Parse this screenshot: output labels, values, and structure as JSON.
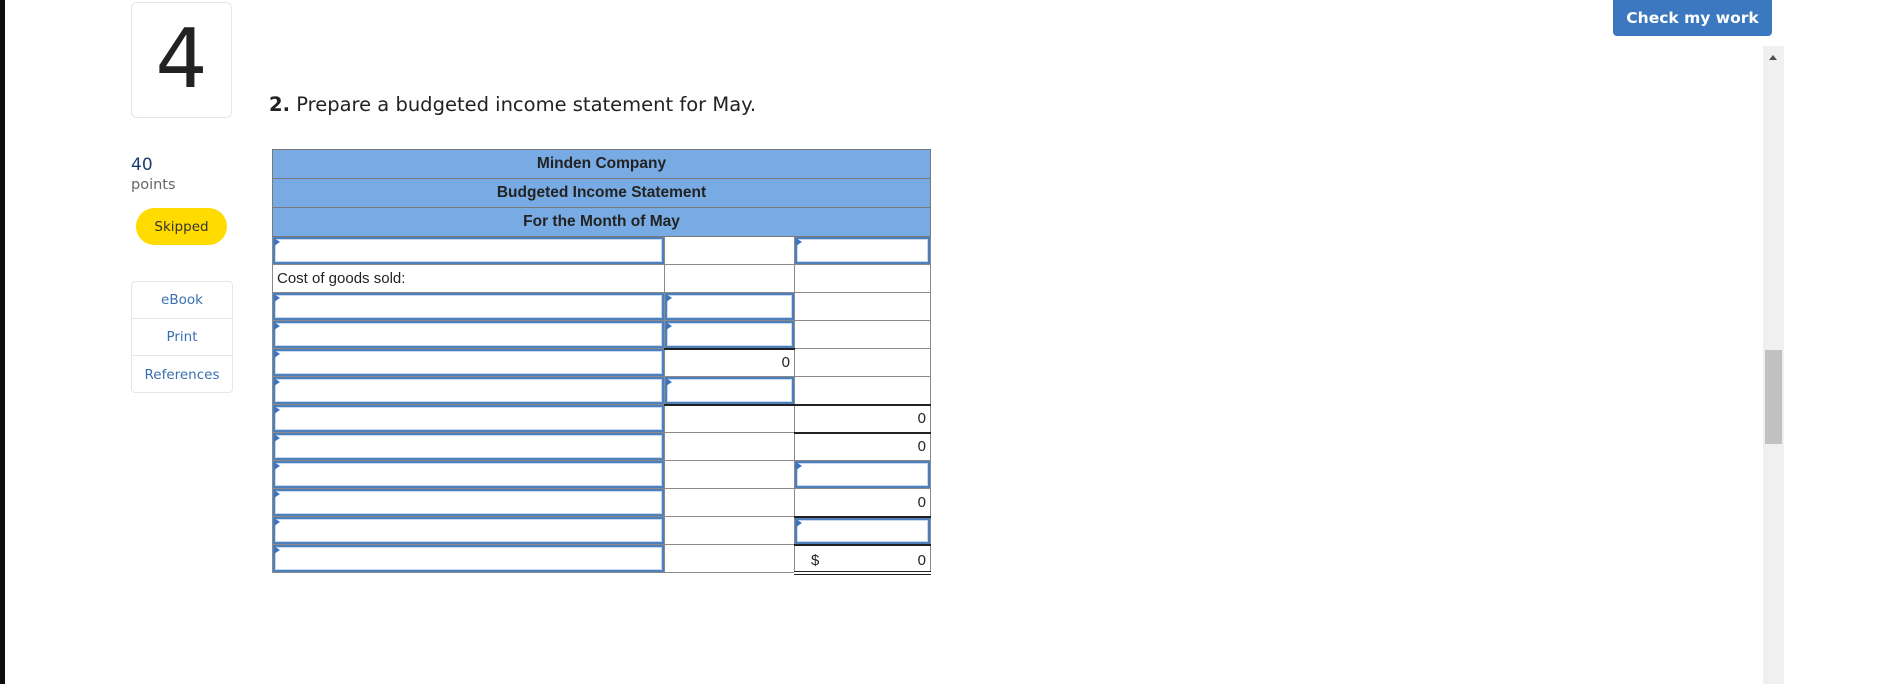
{
  "question_nav": {
    "number": "4"
  },
  "score": {
    "value": "40",
    "label": "points"
  },
  "status": {
    "label": "Skipped",
    "color": "#ffdb00"
  },
  "resources": [
    {
      "label": "eBook"
    },
    {
      "label": "Print"
    },
    {
      "label": "References"
    }
  ],
  "header": {
    "check_button": "Check my work",
    "accent": "#3b78bf"
  },
  "question": {
    "prefix": "2.",
    "text": "Prepare a budgeted income statement for May."
  },
  "statement": {
    "company": "Minden Company",
    "title": "Budgeted Income Statement",
    "period": "For the Month of May",
    "header_color": "#78abe3",
    "rows": [
      {
        "c1": {
          "type": "input",
          "value": ""
        },
        "c2": {
          "type": "empty"
        },
        "c3": {
          "type": "input",
          "value": ""
        }
      },
      {
        "c1": {
          "type": "label",
          "value": "Cost of goods sold:"
        },
        "c2": {
          "type": "empty"
        },
        "c3": {
          "type": "empty"
        }
      },
      {
        "c1": {
          "type": "input",
          "value": ""
        },
        "c2": {
          "type": "input",
          "value": ""
        },
        "c3": {
          "type": "empty"
        }
      },
      {
        "c1": {
          "type": "input",
          "value": ""
        },
        "c2": {
          "type": "input",
          "value": ""
        },
        "c3": {
          "type": "empty"
        }
      },
      {
        "c1": {
          "type": "input",
          "value": ""
        },
        "c2": {
          "type": "value",
          "value": "0"
        },
        "c3": {
          "type": "empty"
        }
      },
      {
        "c1": {
          "type": "input",
          "value": ""
        },
        "c2": {
          "type": "input",
          "value": ""
        },
        "c3": {
          "type": "empty"
        }
      },
      {
        "c1": {
          "type": "input",
          "value": ""
        },
        "c2": {
          "type": "empty"
        },
        "c3": {
          "type": "value",
          "value": "0"
        }
      },
      {
        "c1": {
          "type": "input",
          "value": ""
        },
        "c2": {
          "type": "empty"
        },
        "c3": {
          "type": "value",
          "value": "0"
        }
      },
      {
        "c1": {
          "type": "input",
          "value": ""
        },
        "c2": {
          "type": "empty"
        },
        "c3": {
          "type": "input",
          "value": ""
        }
      },
      {
        "c1": {
          "type": "input",
          "value": ""
        },
        "c2": {
          "type": "empty"
        },
        "c3": {
          "type": "value",
          "value": "0"
        }
      },
      {
        "c1": {
          "type": "input",
          "value": ""
        },
        "c2": {
          "type": "empty"
        },
        "c3": {
          "type": "input",
          "value": ""
        }
      },
      {
        "c1": {
          "type": "input",
          "value": ""
        },
        "c2": {
          "type": "empty"
        },
        "c3": {
          "type": "total",
          "currency": "$",
          "value": "0"
        }
      }
    ]
  }
}
